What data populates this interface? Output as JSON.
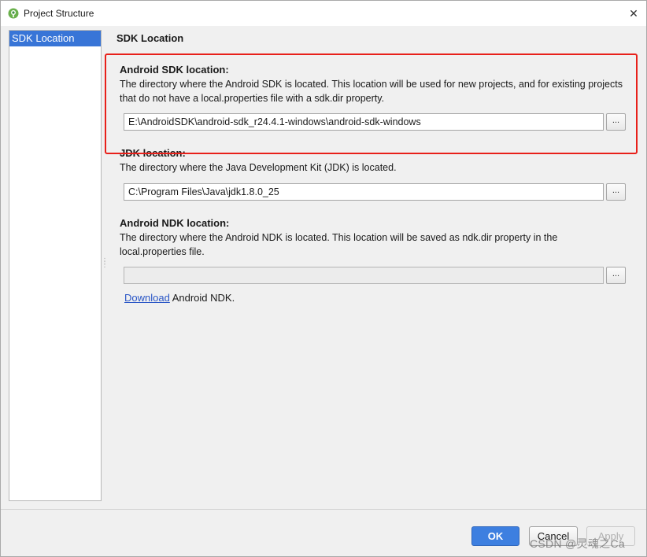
{
  "window": {
    "title": "Project Structure",
    "close_glyph": "✕"
  },
  "sidebar": {
    "items": [
      {
        "label": "SDK Location",
        "selected": true
      }
    ]
  },
  "main": {
    "section_title": "SDK Location",
    "android_sdk": {
      "title": "Android SDK location:",
      "description": "The directory where the Android SDK is located. This location will be used for new projects, and for existing projects that do not have a local.properties file with a sdk.dir property.",
      "path": "E:\\AndroidSDK\\android-sdk_r24.4.1-windows\\android-sdk-windows",
      "browse_label": "..."
    },
    "jdk": {
      "title": "JDK location:",
      "description": "The directory where the Java Development Kit (JDK) is located.",
      "path": "C:\\Program Files\\Java\\jdk1.8.0_25",
      "browse_label": "..."
    },
    "android_ndk": {
      "title": "Android NDK location:",
      "description": "The directory where the Android NDK is located. This location will be saved as ndk.dir property in the local.properties file.",
      "path": "",
      "browse_label": "...",
      "download_link": "Download",
      "download_suffix": " Android NDK."
    }
  },
  "footer": {
    "ok_label": "OK",
    "cancel_label": "Cancel",
    "apply_label": "Apply"
  },
  "watermark": "CSDN @灵魂之Ca",
  "colors": {
    "selection": "#3875d7",
    "highlight_border": "#e8201a",
    "ok_button": "#3d7fe0",
    "link": "#2a56c6"
  },
  "icons": {
    "app": "android-studio-icon",
    "close": "close-icon"
  }
}
